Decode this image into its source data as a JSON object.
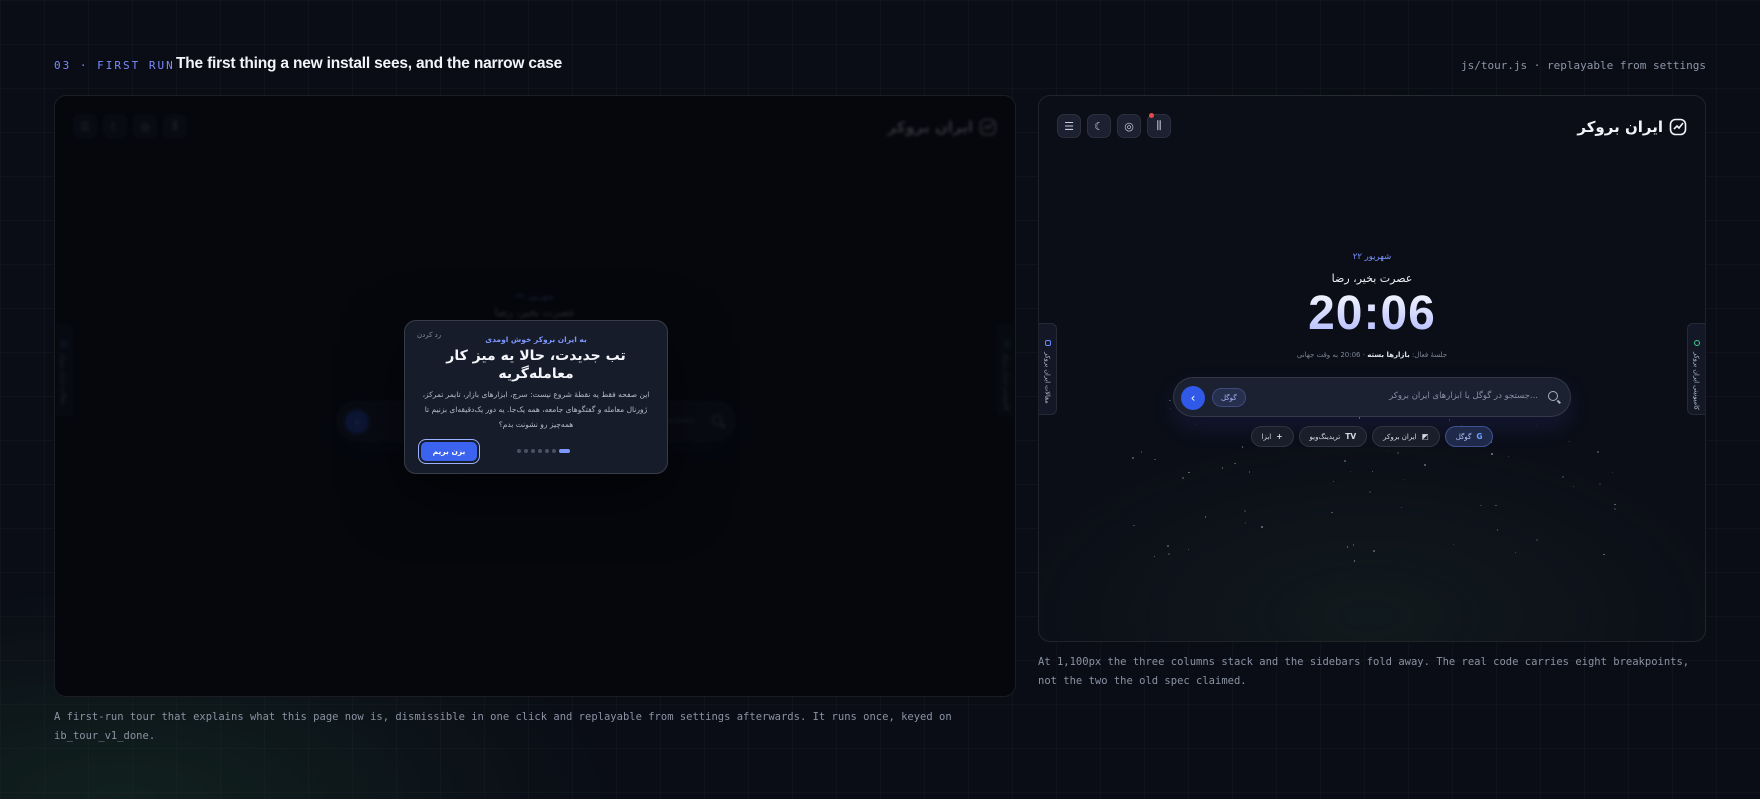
{
  "header": {
    "eyebrow": "03 · FIRST RUN",
    "title": "The first thing a new install sees, and the narrow case",
    "file": "js/tour.js · replayable from settings"
  },
  "app": {
    "brand": "ایران بروکر",
    "toolbar": [
      "sliders-icon",
      "moon-icon",
      "compass-icon",
      "equalizer-icon"
    ],
    "left_sidebar_label": "مقالات ایران بروکر",
    "right_sidebar_label": "کامیونیتی ایران بروکر",
    "date": "۲۲ شهریور",
    "greeting": "عصرت بخیر، رضا",
    "clock": "20:06",
    "markets_prefix": "جلسهٔ فعال:",
    "markets_bold": "بازارها بسته",
    "markets_suffix": "· 20:06 به وقت جهانی",
    "search": {
      "engine": "گوگل",
      "placeholder": "جستجو در گوگل یا ابزارهای ایران بروکر..."
    },
    "chips": [
      {
        "label": "گوگل",
        "icon": "google-icon",
        "glyph": "G"
      },
      {
        "label": "ایران بروکر",
        "icon": "brand-icon",
        "glyph": "◩"
      },
      {
        "label": "تریدینگ‌ویو",
        "icon": "tradingview-icon",
        "glyph": "TV"
      },
      {
        "label": "ابزا",
        "icon": "plus-icon",
        "glyph": "+"
      }
    ]
  },
  "tour": {
    "skip": "رد کردن",
    "kicker": "به ایران بروکر خوش اومدی",
    "title": "تب جدیدت، حالا یه میز کار معامله‌گریه",
    "body": "این صفحه فقط یه نقطهٔ شروع نیست: سرچ، ابزارهای بازار، تایمر تمرکز، ژورنال معامله و گفتگوهای جامعه، همه یک‌جا. یه دور یک‌دقیقه‌ای بزنیم تا همه‌چیز رو نشونت بدم؟",
    "cta": "بزن بریم",
    "steps": 7,
    "current": 7
  },
  "captions": {
    "left": "A first-run tour that explains what this page now is, dismissible in one click and replayable from settings afterwards. It runs once, keyed on ib_tour_v1_done.",
    "right": "At 1,100px the three columns stack and the sidebars fold away. The real code carries eight breakpoints, not the two the old spec claimed."
  }
}
